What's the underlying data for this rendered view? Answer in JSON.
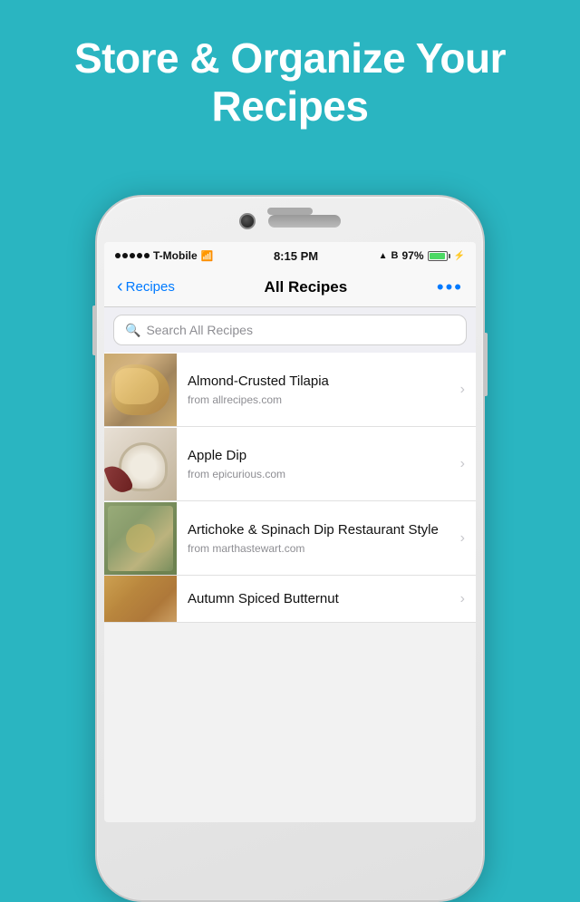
{
  "hero": {
    "title": "Store & Organize Your Recipes"
  },
  "statusBar": {
    "carrier": "T-Mobile",
    "time": "8:15 PM",
    "battery": "97%",
    "signal": 5
  },
  "navbar": {
    "backLabel": "Recipes",
    "title": "All Recipes",
    "moreLabel": "•••"
  },
  "search": {
    "placeholder": "Search All Recipes"
  },
  "recipes": [
    {
      "name": "Almond-Crusted Tilapia",
      "source": "from allrecipes.com",
      "foodClass": "food-tilapia"
    },
    {
      "name": "Apple Dip",
      "source": "from epicurious.com",
      "foodClass": "food-appledip"
    },
    {
      "name": "Artichoke & Spinach Dip Restaurant Style",
      "source": "from marthastewart.com",
      "foodClass": "food-artichoke"
    },
    {
      "name": "Autumn Spiced Butternut",
      "source": "",
      "foodClass": "food-autumn"
    }
  ]
}
